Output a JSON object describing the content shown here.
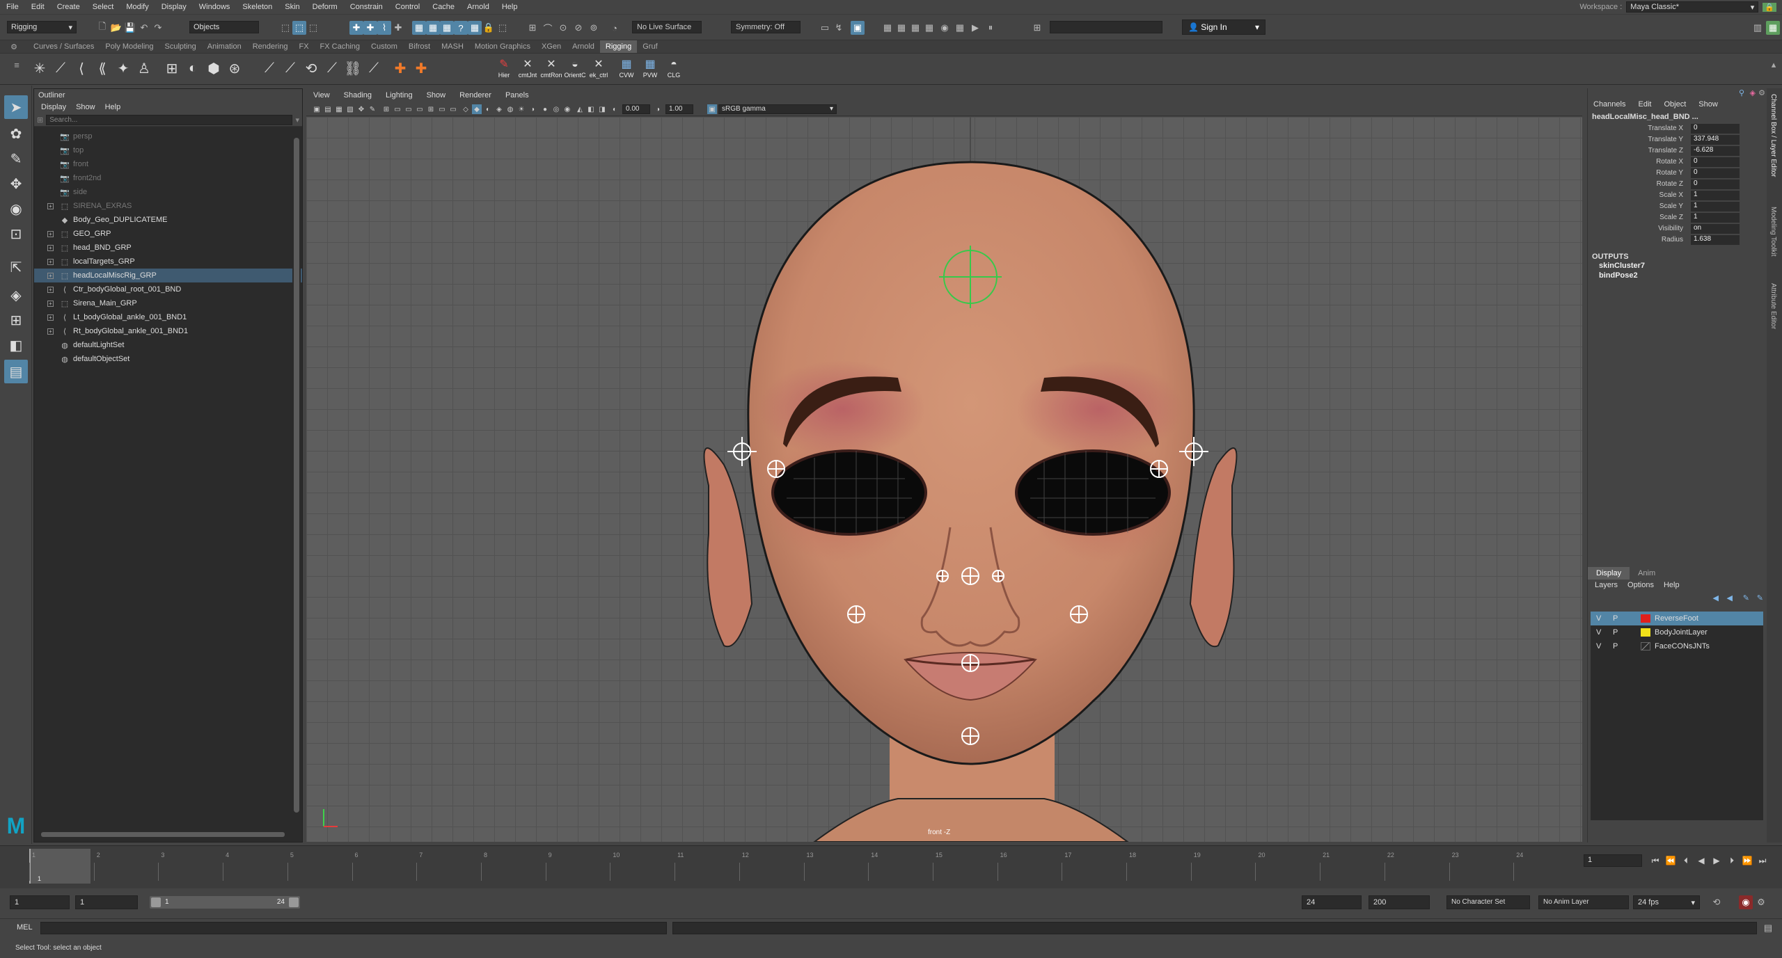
{
  "menubar": {
    "items": [
      "File",
      "Edit",
      "Create",
      "Select",
      "Modify",
      "Display",
      "Windows",
      "Skeleton",
      "Skin",
      "Deform",
      "Constrain",
      "Control",
      "Cache",
      "Arnold",
      "Help"
    ],
    "workspace_label": "Workspace :",
    "workspace_value": "Maya Classic*"
  },
  "statusline": {
    "mode": "Rigging",
    "select_mode": "Objects",
    "live_surface": "No Live Surface",
    "symmetry": "Symmetry: Off",
    "signin": "Sign In"
  },
  "shelf": {
    "tabs": [
      "Curves / Surfaces",
      "Poly Modeling",
      "Sculpting",
      "Animation",
      "Rendering",
      "FX",
      "FX Caching",
      "Custom",
      "Bifrost",
      "MASH",
      "Motion Graphics",
      "XGen",
      "Arnold",
      "Rigging",
      "Gruf"
    ],
    "active_tab": "Rigging",
    "labeled_buttons": [
      "Hier",
      "cmtJnt",
      "cmtRon",
      "OrientC",
      "ek_ctrl",
      "CVW",
      "PVW",
      "CLG"
    ]
  },
  "outliner": {
    "title": "Outliner",
    "menu": [
      "Display",
      "Show",
      "Help"
    ],
    "search_placeholder": "Search...",
    "rows": [
      {
        "label": "persp",
        "icon": "camera-icon",
        "expandable": false,
        "dim": true
      },
      {
        "label": "top",
        "icon": "camera-icon",
        "expandable": false,
        "dim": true
      },
      {
        "label": "front",
        "icon": "camera-icon",
        "expandable": false,
        "dim": true
      },
      {
        "label": "front2nd",
        "icon": "camera-icon",
        "expandable": false,
        "dim": true
      },
      {
        "label": "side",
        "icon": "camera-icon",
        "expandable": false,
        "dim": true
      },
      {
        "label": "SIRENA_EXRAS",
        "icon": "group-icon",
        "expandable": true,
        "dim": true
      },
      {
        "label": "Body_Geo_DUPLICATEME",
        "icon": "mesh-icon",
        "expandable": false,
        "dim": false
      },
      {
        "label": "GEO_GRP",
        "icon": "group-icon",
        "expandable": true,
        "dim": false
      },
      {
        "label": "head_BND_GRP",
        "icon": "group-icon",
        "expandable": true,
        "dim": false
      },
      {
        "label": "localTargets_GRP",
        "icon": "group-icon",
        "expandable": true,
        "dim": false
      },
      {
        "label": "headLocalMiscRig_GRP",
        "icon": "group-icon",
        "expandable": true,
        "dim": false,
        "selected": true
      },
      {
        "label": "Ctr_bodyGlobal_root_001_BND",
        "icon": "joint-icon",
        "expandable": true,
        "dim": false
      },
      {
        "label": "Sirena_Main_GRP",
        "icon": "group-icon",
        "expandable": true,
        "dim": false
      },
      {
        "label": "Lt_bodyGlobal_ankle_001_BND1",
        "icon": "joint-icon",
        "expandable": true,
        "dim": false
      },
      {
        "label": "Rt_bodyGlobal_ankle_001_BND1",
        "icon": "joint-icon",
        "expandable": true,
        "dim": false
      },
      {
        "label": "defaultLightSet",
        "icon": "set-icon",
        "expandable": false,
        "dim": false
      },
      {
        "label": "defaultObjectSet",
        "icon": "set-icon",
        "expandable": false,
        "dim": false
      }
    ]
  },
  "viewport": {
    "menu": [
      "View",
      "Shading",
      "Lighting",
      "Show",
      "Renderer",
      "Panels"
    ],
    "exposure": "0.00",
    "gamma": "1.00",
    "color_space": "sRGB gamma",
    "camera_label": "front -Z"
  },
  "channelbox": {
    "tabs": [
      "Channels",
      "Edit",
      "Object",
      "Show"
    ],
    "node": "headLocalMisc_head_BND ...",
    "attributes": [
      {
        "name": "Translate X",
        "value": "0"
      },
      {
        "name": "Translate Y",
        "value": "337.948"
      },
      {
        "name": "Translate Z",
        "value": "-6.628"
      },
      {
        "name": "Rotate X",
        "value": "0"
      },
      {
        "name": "Rotate Y",
        "value": "0"
      },
      {
        "name": "Rotate Z",
        "value": "0"
      },
      {
        "name": "Scale X",
        "value": "1"
      },
      {
        "name": "Scale Y",
        "value": "1"
      },
      {
        "name": "Scale Z",
        "value": "1"
      },
      {
        "name": "Visibility",
        "value": "on"
      },
      {
        "name": "Radius",
        "value": "1.638"
      }
    ],
    "outputs_label": "OUTPUTS",
    "outputs": [
      "skinCluster7",
      "bindPose2"
    ]
  },
  "layer_editor": {
    "tabs": [
      "Display",
      "Anim"
    ],
    "menu": [
      "Layers",
      "Options",
      "Help"
    ],
    "layers": [
      {
        "v": "V",
        "p": "P",
        "color": "#e0201c",
        "name": "ReverseFoot",
        "selected": true
      },
      {
        "v": "V",
        "p": "P",
        "color": "#f2e21a",
        "name": "BodyJointLayer",
        "selected": false
      },
      {
        "v": "V",
        "p": "P",
        "color": "",
        "name": "FaceCONsJNTs",
        "selected": false
      }
    ]
  },
  "side_tabs": [
    "Channel Box / Layer Editor",
    "Modeling Toolkit",
    "Attribute Editor"
  ],
  "timeline": {
    "ticks": [
      "1",
      "2",
      "3",
      "4",
      "5",
      "6",
      "7",
      "8",
      "9",
      "10",
      "11",
      "12",
      "13",
      "14",
      "15",
      "16",
      "17",
      "18",
      "19",
      "20",
      "21",
      "22",
      "23",
      "24"
    ],
    "current_frame": "1",
    "current_frame_field": "1"
  },
  "rangebar": {
    "start": "1",
    "playback_start": "1",
    "slider_start": "1",
    "slider_end": "24",
    "playback_end": "24",
    "end": "200",
    "character_set": "No Character Set",
    "anim_layer": "No Anim Layer",
    "fps": "24 fps"
  },
  "cmdline": {
    "label": "MEL"
  },
  "helpline": {
    "text": "Select Tool: select an object"
  }
}
